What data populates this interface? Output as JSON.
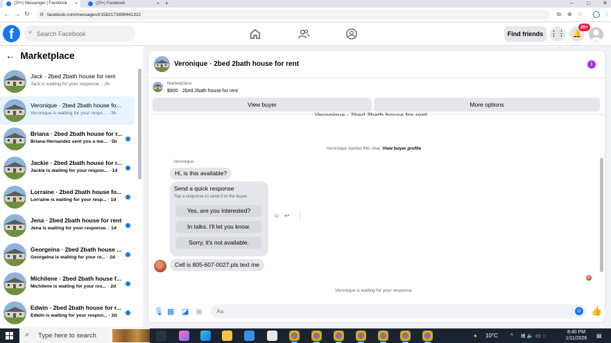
{
  "browser": {
    "tabs": [
      {
        "label": "(20+) Messenger | Facebook",
        "active": true
      },
      {
        "label": "(20+) Facebook",
        "active": false
      }
    ],
    "new_tab": "+",
    "url": "facebook.com/messages/t/1582173899441322",
    "window_controls": {
      "minimize": "–",
      "maximize": "□",
      "close": "✕"
    }
  },
  "topbar": {
    "logo": "f",
    "search_placeholder": "Search Facebook",
    "find_friends": "Find friends",
    "notification_badge": "20+",
    "nav_icons": [
      "home-icon",
      "friends-icon",
      "groups-icon"
    ]
  },
  "sidebar": {
    "title": "Marketplace",
    "conversations": [
      {
        "name": "Jack · 2bed 2bath house for rent",
        "preview": "Jack is waiting for your response. · 2h",
        "unread": false
      },
      {
        "name": "Veronique · 2bed 2bath house fo...",
        "preview": "Veronique is waiting for your respo... · 3h",
        "unread": false,
        "active": true
      },
      {
        "name": "Briana · 2bed 2bath house for r...",
        "preview": "Briana Hernandez sent you a me... · 5h",
        "unread": true
      },
      {
        "name": "Jackie · 2bed 2bath house for r...",
        "preview": "Jackie is waiting for your respon... · 1d",
        "unread": true
      },
      {
        "name": "Lorraine · 2bed 2bath house fo...",
        "preview": "Lorraine is waiting for your resp... · 1d",
        "unread": true
      },
      {
        "name": "Jena · 2bed 2bath house for rent",
        "preview": "Jena is waiting for your response. · 1d",
        "unread": true
      },
      {
        "name": "Georgeina · 2bed 2bath house ...",
        "preview": "Georgeina is waiting for your re... · 2d",
        "unread": true
      },
      {
        "name": "Michilene · 2bed 2bath house f...",
        "preview": "Michilene is waiting for your res... · 2d",
        "unread": true
      },
      {
        "name": "Edwin · 2bed 2bath house for r...",
        "preview": "Edwin is waiting for your respon... · 2d",
        "unread": true
      }
    ]
  },
  "chat": {
    "title": "Veronique · 2bed 2bath house for rent",
    "listing_source": "Marketplace",
    "listing_detail": "$900 · 2bed 2bath house for rent",
    "view_buyer": "View buyer",
    "more_options": "More options",
    "cutoff_header": "Veronique · 2bed 2bath house for rent",
    "started_text": "Veronique started this chat.",
    "view_buyer_profile": "View buyer profile",
    "sender_name": "Veronique",
    "first_message": "Hi, is this available?",
    "quick_response": {
      "title": "Send a quick response",
      "subtitle": "Tap a response to send it to the buyer.",
      "options": [
        "Yes, are you interested?",
        "In talks. I'll let you know.",
        "Sorry, it's not available."
      ]
    },
    "second_message": "Cell is 805-607-0027.pls text me",
    "waiting_text": "Veronique is waiting for your response.",
    "composer_placeholder": "Aa"
  },
  "taskbar": {
    "search_placeholder": "Type here to search",
    "temperature": "10°C",
    "time": "8:40 PM",
    "date": "1/11/2026"
  },
  "colors": {
    "facebook_blue": "#1877f2",
    "unread_dot": "#1877f2",
    "notification_red": "#e41e3f",
    "info_purple": "#a033ff"
  }
}
